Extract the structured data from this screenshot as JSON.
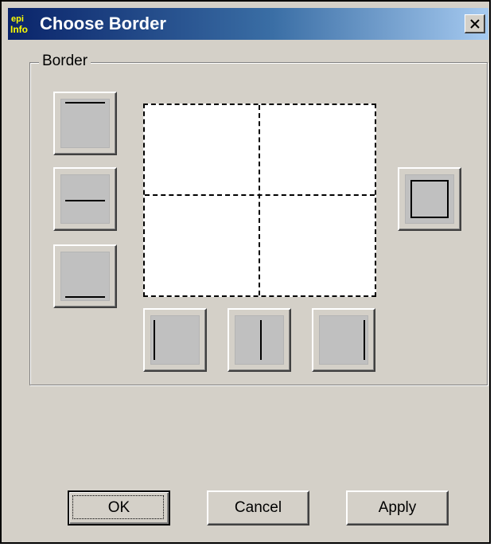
{
  "window": {
    "title": "Choose Border",
    "app_logo_text_top": "epi",
    "app_logo_text_bottom": "Info"
  },
  "titlebar": {
    "close_glyph": "×"
  },
  "border_group": {
    "label": "Border",
    "buttons": [
      {
        "name": "top-border-button",
        "icon": "border-top-icon"
      },
      {
        "name": "middle-horizontal-border-button",
        "icon": "border-horizontal-inner-icon"
      },
      {
        "name": "bottom-border-button",
        "icon": "border-bottom-icon"
      },
      {
        "name": "left-border-button",
        "icon": "border-left-icon"
      },
      {
        "name": "middle-vertical-border-button",
        "icon": "border-vertical-inner-icon"
      },
      {
        "name": "right-border-button",
        "icon": "border-right-icon"
      },
      {
        "name": "outline-border-button",
        "icon": "border-outline-icon"
      }
    ]
  },
  "footer": {
    "ok_label": "OK",
    "cancel_label": "Cancel",
    "apply_label": "Apply"
  },
  "colors": {
    "dialog_bg": "#d4d0c8",
    "titlebar_start": "#0a246a",
    "titlebar_end": "#a6caf0",
    "title_text": "#ffffff"
  }
}
